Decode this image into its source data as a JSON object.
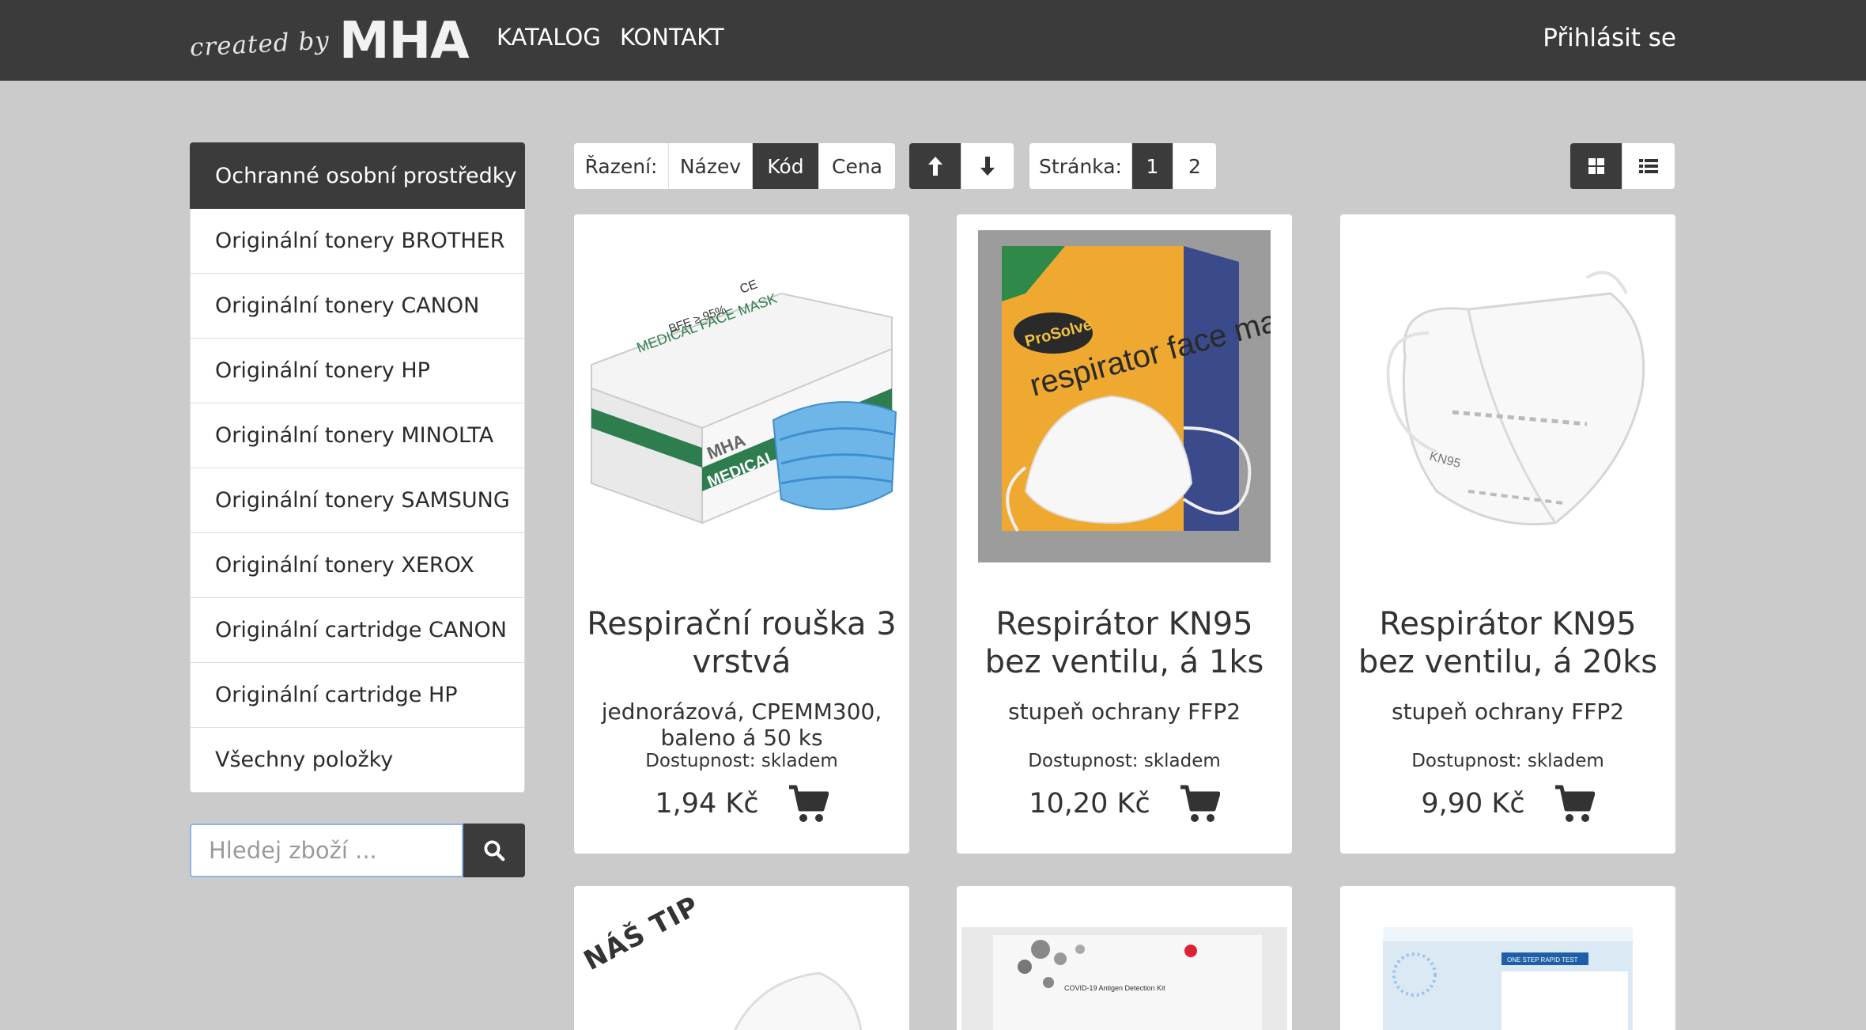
{
  "header": {
    "logo_small": "created by",
    "logo_big": "MHA",
    "nav": [
      "KATALOG",
      "KONTAKT"
    ],
    "login": "Přihlásit se"
  },
  "sidebar": {
    "categories": [
      "Ochranné osobní prostředky",
      "Originální tonery BROTHER",
      "Originální tonery CANON",
      "Originální tonery HP",
      "Originální tonery MINOLTA",
      "Originální tonery SAMSUNG",
      "Originální tonery XEROX",
      "Originální cartridge CANON",
      "Originální cartridge HP",
      "Všechny položky"
    ],
    "search_placeholder": "Hledej zboží ..."
  },
  "toolbar": {
    "sort_label": "Řazení:",
    "sort_options": [
      "Název",
      "Kód",
      "Cena"
    ],
    "sort_active": "Kód",
    "page_label": "Stránka:",
    "pages": [
      "1",
      "2"
    ],
    "page_active": "1",
    "icons": [
      "arrow-up-icon",
      "arrow-down-icon",
      "grid-view-icon",
      "list-view-icon"
    ]
  },
  "products": [
    {
      "title": "Respirační rouška 3 vrstvá",
      "subtitle": "jednorázová, CPEMM300, baleno á 50 ks",
      "availability": "Dostupnost: skladem",
      "price": "1,94 Kč",
      "image_text": {
        "brand": "MHA",
        "box": "MEDICAL FACE MASK",
        "cert": "CE",
        "bfe": "BFE ≥ 95%"
      }
    },
    {
      "title": "Respirátor KN95 bez ventilu, á 1ks",
      "subtitle": "stupeň ochrany FFP2",
      "availability": "Dostupnost: skladem",
      "price": "10,20 Kč",
      "image_text": {
        "brand": "ProSolve",
        "box": "respirator face mask"
      }
    },
    {
      "title": "Respirátor KN95 bez ventilu, á 20ks",
      "subtitle": "stupeň ochrany FFP2",
      "availability": "Dostupnost: skladem",
      "price": "9,90 Kč",
      "image_text": {
        "label": "KN95"
      }
    }
  ],
  "second_row": {
    "tip": "NÁŠ TIP",
    "kit_label": "COVID-19 Antigen Detection Kit",
    "test_label": "ONE STEP RAPID TEST"
  },
  "colors": {
    "header_bg": "#3b3b3b",
    "page_bg": "#cbcbcb",
    "active_bg": "#3b3b3b",
    "card_bg": "#ffffff",
    "search_focus": "#8db4e3"
  }
}
